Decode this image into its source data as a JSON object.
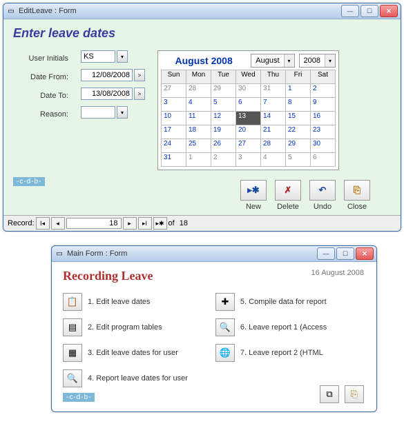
{
  "window1": {
    "title": "EditLeave : Form",
    "form_title": "Enter leave dates",
    "labels": {
      "user_initials": "User Initials",
      "date_from": "Date From:",
      "date_to": "Date To:",
      "reason": "Reason:"
    },
    "fields": {
      "user_initials": "KS",
      "date_from": "12/08/2008",
      "date_to": "13/08/2008",
      "reason": ""
    },
    "cdb": "-c-d-b-",
    "actions": {
      "new": "New",
      "delete": "Delete",
      "undo": "Undo",
      "close": "Close"
    },
    "record": {
      "label": "Record:",
      "current": "18",
      "of": "of",
      "total": "18"
    }
  },
  "calendar": {
    "title": "August 2008",
    "month_select": "August",
    "year_select": "2008",
    "headers": [
      "Sun",
      "Mon",
      "Tue",
      "Wed",
      "Thu",
      "Fri",
      "Sat"
    ],
    "rows": [
      [
        {
          "d": "27",
          "o": true
        },
        {
          "d": "28",
          "o": true
        },
        {
          "d": "29",
          "o": true
        },
        {
          "d": "30",
          "o": true
        },
        {
          "d": "31",
          "o": true
        },
        {
          "d": "1"
        },
        {
          "d": "2"
        }
      ],
      [
        {
          "d": "3"
        },
        {
          "d": "4"
        },
        {
          "d": "5"
        },
        {
          "d": "6"
        },
        {
          "d": "7"
        },
        {
          "d": "8"
        },
        {
          "d": "9"
        }
      ],
      [
        {
          "d": "10"
        },
        {
          "d": "11"
        },
        {
          "d": "12"
        },
        {
          "d": "13",
          "sel": true
        },
        {
          "d": "14"
        },
        {
          "d": "15"
        },
        {
          "d": "16"
        }
      ],
      [
        {
          "d": "17"
        },
        {
          "d": "18"
        },
        {
          "d": "19"
        },
        {
          "d": "20"
        },
        {
          "d": "21"
        },
        {
          "d": "22"
        },
        {
          "d": "23"
        }
      ],
      [
        {
          "d": "24"
        },
        {
          "d": "25"
        },
        {
          "d": "26"
        },
        {
          "d": "27"
        },
        {
          "d": "28"
        },
        {
          "d": "29"
        },
        {
          "d": "30"
        }
      ],
      [
        {
          "d": "31"
        },
        {
          "d": "1",
          "o": true
        },
        {
          "d": "2",
          "o": true
        },
        {
          "d": "3",
          "o": true
        },
        {
          "d": "4",
          "o": true
        },
        {
          "d": "5",
          "o": true
        },
        {
          "d": "6",
          "o": true
        }
      ]
    ]
  },
  "window2": {
    "title": "Main Form : Form",
    "heading": "Recording Leave",
    "date": "16 August 2008",
    "items_left": [
      "1. Edit leave dates",
      "2. Edit program tables",
      "3. Edit leave dates for user",
      "4. Report leave dates for user"
    ],
    "items_right": [
      "5. Compile data for report",
      "6. Leave report 1 (Access",
      "7. Leave report 2 (HTML"
    ],
    "cdb": "-c-d-b-"
  }
}
